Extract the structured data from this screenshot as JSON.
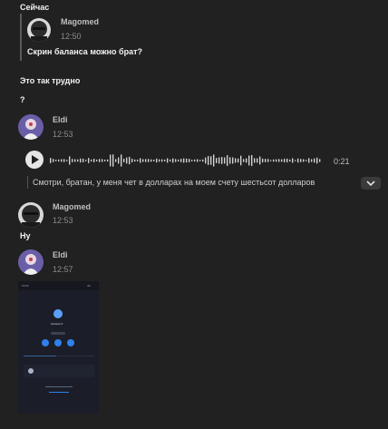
{
  "top_message": {
    "text": "Сейчас"
  },
  "reply": {
    "author": "Magomed",
    "time": "12:50",
    "text": "Скрин баланса можно брат?"
  },
  "messages": [
    {
      "text": "Это так трудно"
    },
    {
      "text": "?"
    }
  ],
  "eldi_voice": {
    "author": "Eldi",
    "time": "12:53",
    "duration": "0:21",
    "transcript": "Смотри, братан, у меня чет в долларах на моем счету шестьсот долларов"
  },
  "magomed_msg": {
    "author": "Magomed",
    "time": "12:53",
    "text": "Ну"
  },
  "eldi_image": {
    "author": "Eldi",
    "time": "12:57"
  },
  "screenshot_content": {
    "title": "Account 2",
    "status_left": "19:03",
    "status_right": "4G",
    "colors": {
      "accent": "#2f80ed",
      "bg": "#1b1e28"
    }
  },
  "colors": {
    "background": "#212121",
    "text": "#f2f2f2",
    "muted": "#8c8c8c"
  },
  "icons": {
    "play": "play-icon",
    "expand": "chevron-down-icon"
  }
}
